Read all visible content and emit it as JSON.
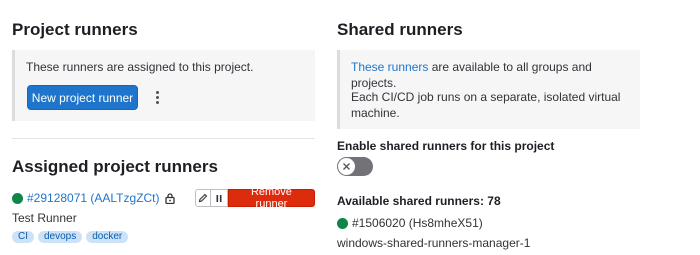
{
  "project_runners": {
    "title": "Project runners",
    "info": "These runners are assigned to this project.",
    "new_button": "New project runner",
    "more_icon": "kebab-vertical-icon"
  },
  "assigned": {
    "title": "Assigned project runners",
    "runner": {
      "id_link": "#29128071 (AALTzgZCt)",
      "status_color": "#108548",
      "locked_icon": "lock-icon",
      "description": "Test Runner",
      "tags": [
        "CI",
        "devops",
        "docker"
      ],
      "edit_icon": "pencil-icon",
      "pause_icon": "pause-icon",
      "remove_label": "Remove runner"
    }
  },
  "shared_runners": {
    "title": "Shared runners",
    "info_link": "These runners",
    "info_rest": " are available to all groups and projects.",
    "info_p2": "Each CI/CD job runs on a separate, isolated virtual machine.",
    "toggle_label": "Enable shared runners for this project",
    "toggle_on": false,
    "available_label": "Available shared runners: 78",
    "runner_id": "#1506020 (Hs8mheX51)",
    "runner_status_color": "#108548",
    "runner_name": "windows-shared-runners-manager-1"
  },
  "colors": {
    "primary": "#1f75cb",
    "danger": "#dd2b0e",
    "online": "#108548",
    "toggle_off": "#737278"
  }
}
